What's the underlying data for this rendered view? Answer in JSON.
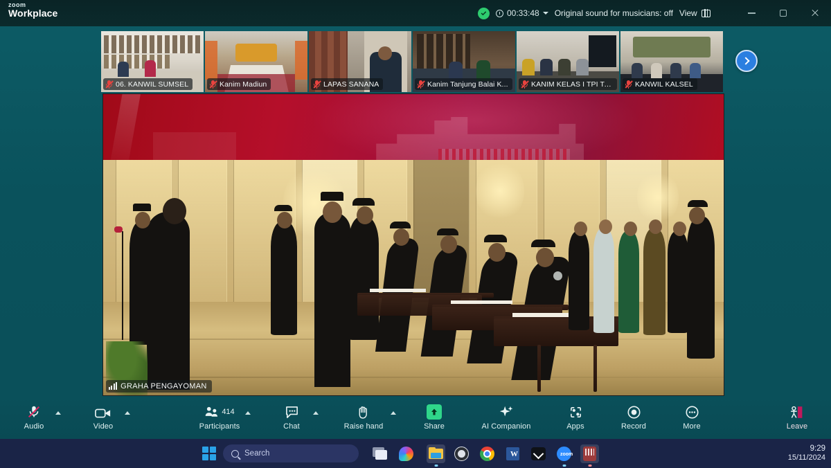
{
  "app": {
    "brand_line1": "zoom",
    "brand_line2": "Workplace"
  },
  "titlebar": {
    "encryption_icon": "shield-check-icon",
    "timer_icon": "clock-icon",
    "timer": "00:33:48",
    "timer_chevron": "chevron-down-icon",
    "original_sound": "Original sound for musicians: off",
    "view_label": "View",
    "view_icon": "grid-view-icon",
    "minimize_icon": "minimize-icon",
    "maximize_icon": "maximize-icon",
    "close_icon": "close-icon"
  },
  "filmstrip": {
    "next_page_icon": "chevron-right-icon",
    "thumbnails": [
      {
        "name": "06. KANWIL SUMSEL",
        "mic": "mic-muted-icon"
      },
      {
        "name": "Kanim Madiun",
        "mic": "mic-muted-icon"
      },
      {
        "name": "LAPAS SANANA",
        "mic": "mic-muted-icon"
      },
      {
        "name": "Kanim Tanjung Balai K...",
        "mic": "mic-muted-icon"
      },
      {
        "name": "KANIM KELAS I TPI TA...",
        "mic": "mic-muted-icon"
      },
      {
        "name": "KANWIL KALSEL",
        "mic": "mic-muted-icon"
      }
    ]
  },
  "stage": {
    "active_speaker": "GRAHA PENGAYOMAN",
    "speaker_icon": "signal-bars-icon"
  },
  "toolbar": {
    "audio": {
      "label": "Audio",
      "icon": "microphone-muted-icon",
      "chevron": "chevron-up-icon"
    },
    "video": {
      "label": "Video",
      "icon": "camera-icon",
      "chevron": "chevron-up-icon"
    },
    "participants": {
      "label": "Participants",
      "icon": "people-icon",
      "count": "414",
      "chevron": "chevron-up-icon"
    },
    "chat": {
      "label": "Chat",
      "icon": "chat-bubble-icon",
      "chevron": "chevron-up-icon"
    },
    "raise_hand": {
      "label": "Raise hand",
      "icon": "hand-icon",
      "chevron": "chevron-up-icon"
    },
    "share": {
      "label": "Share",
      "icon": "share-screen-icon"
    },
    "ai_companion": {
      "label": "AI Companion",
      "icon": "sparkle-icon"
    },
    "apps": {
      "label": "Apps",
      "icon": "apps-icon"
    },
    "record": {
      "label": "Record",
      "icon": "record-icon"
    },
    "more": {
      "label": "More",
      "icon": "ellipsis-icon"
    },
    "leave": {
      "label": "Leave",
      "icon": "leave-meeting-icon"
    }
  },
  "taskbar": {
    "start_icon": "windows-start-icon",
    "search_placeholder": "Search",
    "search_icon": "search-icon",
    "icons": [
      "task-view-icon",
      "copilot-icon",
      "file-explorer-icon",
      "obs-studio-icon",
      "google-chrome-icon",
      "microsoft-word-icon",
      "capcut-icon",
      "zoom-icon",
      "app-red-icon"
    ],
    "clock_time": "9:29",
    "clock_date": "15/11/2024"
  },
  "colors": {
    "zoom_background": "#0a5560",
    "titlebar": "#0b2a2c",
    "accent_blue": "#2b7fe0",
    "share_green": "#2fd68a",
    "leave_red": "#c0185c",
    "banner_red": "#b50f2a",
    "taskbar": "#1a2447"
  }
}
